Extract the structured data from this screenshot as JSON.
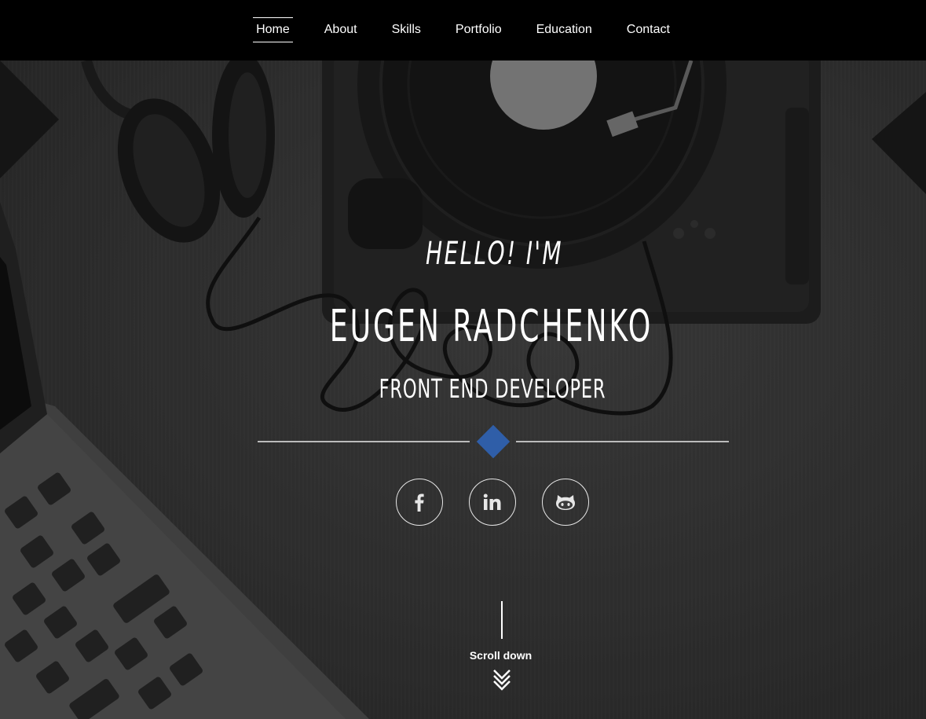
{
  "nav": {
    "items": [
      {
        "label": "Home",
        "active": true
      },
      {
        "label": "About",
        "active": false
      },
      {
        "label": "Skills",
        "active": false
      },
      {
        "label": "Portfolio",
        "active": false
      },
      {
        "label": "Education",
        "active": false
      },
      {
        "label": "Contact",
        "active": false
      }
    ]
  },
  "hero": {
    "greeting": "HELLO! I'M",
    "name": "EUGEN RADCHENKO",
    "role": "FRONT END DEVELOPER",
    "accent_color": "#2f5ea8"
  },
  "social": [
    {
      "icon": "facebook-icon"
    },
    {
      "icon": "linkedin-icon"
    },
    {
      "icon": "github-icon"
    }
  ],
  "scroll": {
    "label": "Scroll down",
    "icon": "double-chevron-down-icon"
  }
}
